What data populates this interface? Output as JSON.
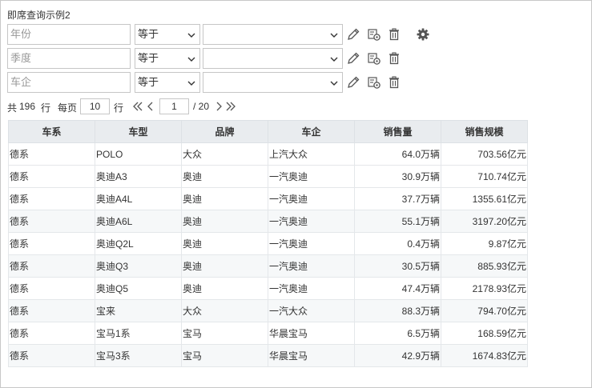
{
  "page": {
    "title": "即席查询示例2"
  },
  "filters": [
    {
      "field_placeholder": "年份",
      "operator": "等于",
      "value": ""
    },
    {
      "field_placeholder": "季度",
      "operator": "等于",
      "value": ""
    },
    {
      "field_placeholder": "车企",
      "operator": "等于",
      "value": ""
    }
  ],
  "icons": {
    "edit": "pencil-icon",
    "config": "gear-list-icon",
    "delete": "trash-icon",
    "settings": "gear-icon"
  },
  "pager": {
    "total_prefix": "共",
    "total": "196",
    "total_suffix": "行",
    "per_page_label": "每页",
    "per_page": "10",
    "rows_suffix": "行",
    "current_page": "1",
    "total_pages": "/ 20"
  },
  "table": {
    "headers": [
      "车系",
      "车型",
      "品牌",
      "车企",
      "销售量",
      "销售规模"
    ],
    "rows": [
      [
        "德系",
        "POLO",
        "大众",
        "上汽大众",
        "64.0万辆",
        "703.56亿元"
      ],
      [
        "德系",
        "奥迪A3",
        "奥迪",
        "一汽奥迪",
        "30.9万辆",
        "710.74亿元"
      ],
      [
        "德系",
        "奥迪A4L",
        "奥迪",
        "一汽奥迪",
        "37.7万辆",
        "1355.61亿元"
      ],
      [
        "德系",
        "奥迪A6L",
        "奥迪",
        "一汽奥迪",
        "55.1万辆",
        "3197.20亿元"
      ],
      [
        "德系",
        "奥迪Q2L",
        "奥迪",
        "一汽奥迪",
        "0.4万辆",
        "9.87亿元"
      ],
      [
        "德系",
        "奥迪Q3",
        "奥迪",
        "一汽奥迪",
        "30.5万辆",
        "885.93亿元"
      ],
      [
        "德系",
        "奥迪Q5",
        "奥迪",
        "一汽奥迪",
        "47.4万辆",
        "2178.93亿元"
      ],
      [
        "德系",
        "宝来",
        "大众",
        "一汽大众",
        "88.3万辆",
        "794.70亿元"
      ],
      [
        "德系",
        "宝马1系",
        "宝马",
        "华晨宝马",
        "6.5万辆",
        "168.59亿元"
      ],
      [
        "德系",
        "宝马3系",
        "宝马",
        "华晨宝马",
        "42.9万辆",
        "1674.83亿元"
      ]
    ]
  },
  "colors": {
    "border": "#c6c6c6",
    "header_bg": "#e9ecef",
    "alt_row_bg": "#f6f8f9",
    "icon": "#555555"
  }
}
